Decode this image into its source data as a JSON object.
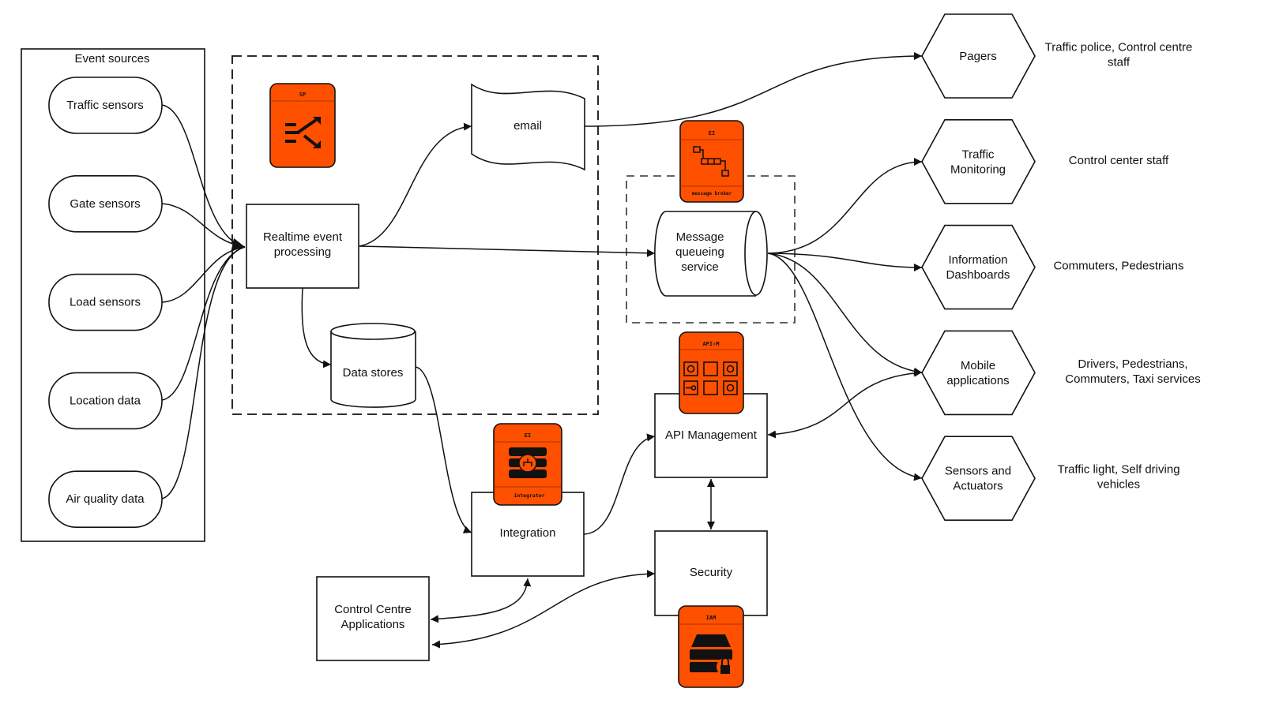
{
  "colors": {
    "accent": "#ff5000",
    "line": "#111111"
  },
  "event_sources": {
    "title": "Event sources",
    "items": [
      "Traffic sensors",
      "Gate sensors",
      "Load sensors",
      "Location data",
      "Air quality data"
    ]
  },
  "nodes": {
    "realtime": [
      "Realtime event",
      "processing"
    ],
    "email": "email",
    "data_stores": "Data stores",
    "mq": [
      "Message",
      "queueing",
      "service"
    ],
    "api": "API Management",
    "integration": "Integration",
    "security": "Security",
    "control": [
      "Control Centre",
      "Applications"
    ]
  },
  "icons": {
    "sp": {
      "label": "SP",
      "icon": "stream-processor-icon"
    },
    "broker": {
      "label": "EI",
      "sub": "message broker",
      "icon": "message-broker-icon"
    },
    "apim": {
      "label": "API-M",
      "icon": "api-manager-icon"
    },
    "integrator": {
      "label": "EI",
      "sub": "integrator",
      "icon": "integrator-icon"
    },
    "iam": {
      "label": "IAM",
      "icon": "identity-server-icon"
    }
  },
  "consumers": [
    {
      "name": [
        "Pagers"
      ],
      "audience": [
        "Traffic police, Control centre",
        "staff"
      ]
    },
    {
      "name": [
        "Traffic",
        "Monitoring"
      ],
      "audience": [
        "Control center staff"
      ]
    },
    {
      "name": [
        "Information",
        "Dashboards"
      ],
      "audience": [
        "Commuters, Pedestrians"
      ]
    },
    {
      "name": [
        "Mobile",
        "applications"
      ],
      "audience": [
        "Drivers, Pedestrians,",
        "Commuters, Taxi services"
      ]
    },
    {
      "name": [
        "Sensors and",
        "Actuators"
      ],
      "audience": [
        "Traffic light, Self driving",
        "vehicles"
      ]
    }
  ]
}
